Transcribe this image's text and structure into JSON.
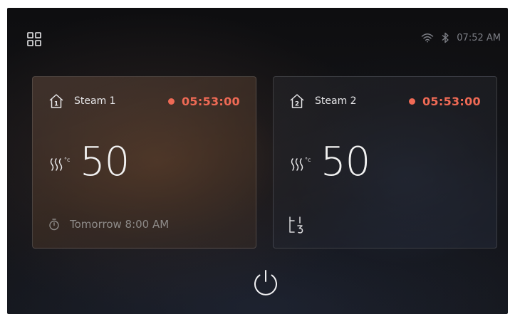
{
  "header": {
    "menu_icon": "grid-menu-icon",
    "wifi_icon": "wifi-icon",
    "bluetooth_icon": "bluetooth-icon",
    "time": "07:52 AM"
  },
  "colors": {
    "accent_timer": "#ef6a55",
    "text_primary": "#f2f2f2",
    "text_muted": "#8d8a88"
  },
  "zones": [
    {
      "number": "1",
      "title": "Steam 1",
      "timer": "05:53:00",
      "temp_icon": "steam-heat-icon",
      "temperature": "50",
      "schedule_icon": "clock-icon",
      "schedule": "Tomorrow 8:00 AM"
    },
    {
      "number": "2",
      "title": "Steam 2",
      "timer": "05:53:00",
      "temp_icon": "steam-heat-icon",
      "temperature": "50",
      "mode_icon": "bath-cycle-icon"
    }
  ],
  "footer": {
    "power_icon": "power-icon"
  }
}
